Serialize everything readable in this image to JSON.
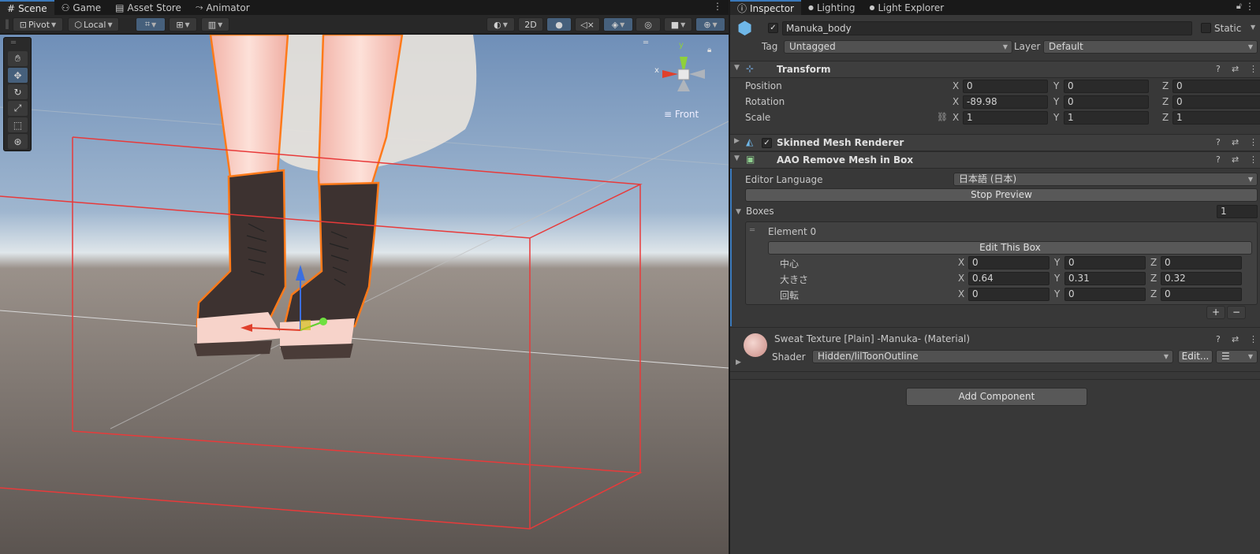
{
  "scene_tabs": [
    {
      "icon": "#",
      "label": "Scene"
    },
    {
      "icon": "⚇",
      "label": "Game"
    },
    {
      "icon": "▤",
      "label": "Asset Store"
    },
    {
      "icon": "⤳",
      "label": "Animator"
    }
  ],
  "scene_toolbar": {
    "pivot": "Pivot",
    "local": "Local",
    "mode_2d": "2D"
  },
  "gizmo": {
    "x": "x",
    "y": "y",
    "view": "Front"
  },
  "inspector_tabs": [
    {
      "icon": "ⓘ",
      "label": "Inspector"
    },
    {
      "icon": "●",
      "label": "Lighting"
    },
    {
      "icon": "●",
      "label": "Light Explorer"
    }
  ],
  "object": {
    "name": "Manuka_body",
    "static_label": "Static",
    "tag_label": "Tag",
    "tag": "Untagged",
    "layer_label": "Layer",
    "layer": "Default"
  },
  "transform": {
    "title": "Transform",
    "rows": [
      {
        "label": "Position",
        "x": "0",
        "y": "0",
        "z": "0"
      },
      {
        "label": "Rotation",
        "x": "-89.98",
        "y": "0",
        "z": "0"
      },
      {
        "label": "Scale",
        "x": "1",
        "y": "1",
        "z": "1"
      }
    ]
  },
  "skinned": {
    "title": "Skinned Mesh Renderer"
  },
  "aao": {
    "title": "AAO Remove Mesh in Box",
    "lang_label": "Editor Language",
    "lang_value": "日本語 (日本)",
    "stop_preview": "Stop Preview",
    "boxes_label": "Boxes",
    "boxes_count": "1",
    "element_label": "Element 0",
    "edit_box": "Edit This Box",
    "rows": [
      {
        "label": "中心",
        "x": "0",
        "y": "0",
        "z": "0"
      },
      {
        "label": "大きさ",
        "x": "0.64",
        "y": "0.31",
        "z": "0.32"
      },
      {
        "label": "回転",
        "x": "0",
        "y": "0",
        "z": "0"
      }
    ],
    "plus": "+",
    "minus": "−"
  },
  "material": {
    "title": "Sweat Texture [Plain] -Manuka- (Material)",
    "shader_label": "Shader",
    "shader": "Hidden/lilToonOutline",
    "edit": "Edit..."
  },
  "add_component": "Add Component",
  "axes": {
    "x": "X",
    "y": "Y",
    "z": "Z"
  },
  "colors": {
    "accent": "#3a79bb",
    "box": "#e83a3a",
    "outline": "#ff7a1a"
  }
}
